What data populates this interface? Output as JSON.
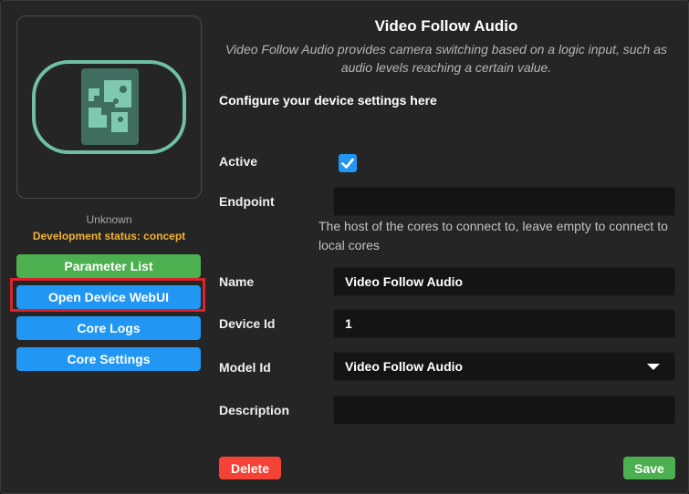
{
  "device": {
    "name_line": "Unknown",
    "status_line": "Development status: concept"
  },
  "sidebar": {
    "buttons": [
      {
        "label": "Parameter List"
      },
      {
        "label": "Open Device WebUI"
      },
      {
        "label": "Core Logs"
      },
      {
        "label": "Core Settings"
      }
    ]
  },
  "header": {
    "title": "Video Follow Audio",
    "description": "Video Follow Audio provides camera switching based on a logic input, such as audio levels reaching a certain value."
  },
  "form": {
    "intro": "Configure your device settings here",
    "active_label": "Active",
    "active_checked": true,
    "endpoint_label": "Endpoint",
    "endpoint_value": "",
    "endpoint_hint": "The host of the cores to connect to, leave empty to connect to local cores",
    "name_label": "Name",
    "name_value": "Video Follow Audio",
    "device_id_label": "Device Id",
    "device_id_value": "1",
    "model_id_label": "Model Id",
    "model_id_value": "Video Follow Audio",
    "description_label": "Description",
    "description_value": ""
  },
  "actions": {
    "delete_label": "Delete",
    "save_label": "Save"
  },
  "colors": {
    "accent_blue": "#2196f3",
    "accent_green": "#4caf50",
    "danger_red": "#f44336",
    "status_yellow": "#f2b233",
    "highlight_red": "#d9232d",
    "icon_teal": "#6fbfa6"
  },
  "icons": {
    "device_image": "video-follow-audio-device-icon",
    "checkbox": "checkmark-icon",
    "dropdown": "caret-down-icon"
  }
}
